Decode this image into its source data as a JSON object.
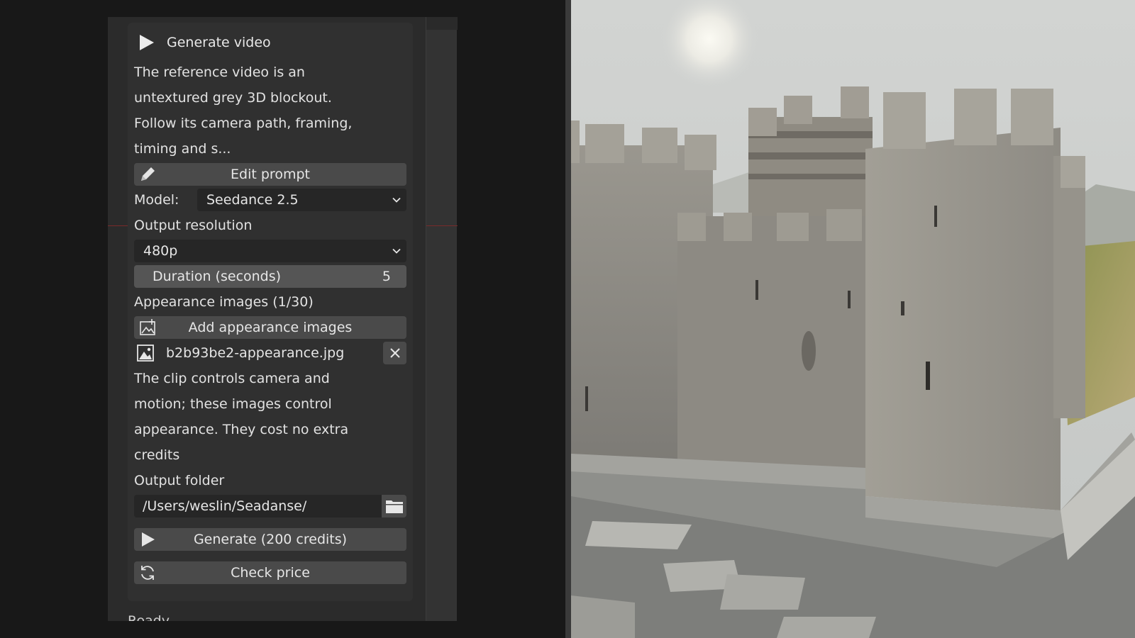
{
  "panel": {
    "header_title": "Generate video",
    "prompt_lines": [
      "The reference video is an",
      "untextured grey 3D blockout.",
      "Follow its camera path, framing,",
      "timing and s..."
    ],
    "edit_prompt_label": "Edit prompt",
    "model_label": "Model:",
    "model_value": "Seedance 2.5",
    "output_resolution_label": "Output resolution",
    "resolution_value": "480p",
    "duration_label": "Duration (seconds)",
    "duration_value": "5",
    "appearance_heading": "Appearance images (1/30)",
    "add_appearance_label": "Add appearance images",
    "appearance_file": "b2b93be2-appearance.jpg",
    "info_lines": [
      "The clip controls camera and",
      "motion; these images control",
      "appearance. They cost no extra",
      "credits"
    ],
    "output_folder_label": "Output folder",
    "output_folder_value": "/Users/weslin/Seadanse/",
    "generate_label": "Generate (200 credits)",
    "check_price_label": "Check price"
  },
  "status_text": "Ready",
  "viewport": {
    "subject": "stone-castle-render",
    "sky_color": "#c9ccca",
    "stone_color": "#8d8c86",
    "grass_color": "#9a9a54"
  },
  "icons": {
    "header": "play-icon",
    "edit": "pencil-icon",
    "add_image": "add-image-icon",
    "file": "image-file-icon",
    "remove": "close-icon",
    "folder": "folder-icon",
    "generate": "play-icon",
    "check": "refresh-icon",
    "dropdown": "chevron-down-icon"
  }
}
